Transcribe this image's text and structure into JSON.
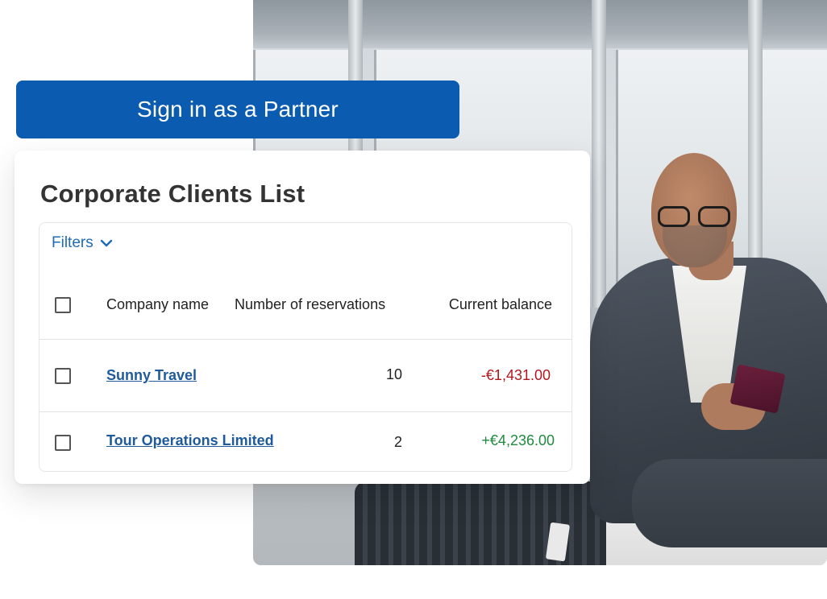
{
  "signin": {
    "label": "Sign in as a Partner"
  },
  "card": {
    "title": "Corporate Clients List",
    "filters_label": "Filters",
    "columns": {
      "company": "Company name",
      "reservations": "Number of reservations",
      "balance": "Current balance"
    },
    "rows": [
      {
        "company": "Sunny Travel",
        "reservations": "10",
        "balance": "-€1,431.00",
        "balance_sign": "negative"
      },
      {
        "company": "Tour Operations Limited",
        "reservations": "2",
        "balance": "+€4,236.00",
        "balance_sign": "positive"
      }
    ]
  },
  "colors": {
    "brand_blue": "#0b5cb0",
    "link_blue": "#1e5a9c",
    "negative": "#b0171f",
    "positive": "#1f8a3c"
  },
  "icons": {
    "filters": "chevron-down-icon"
  }
}
